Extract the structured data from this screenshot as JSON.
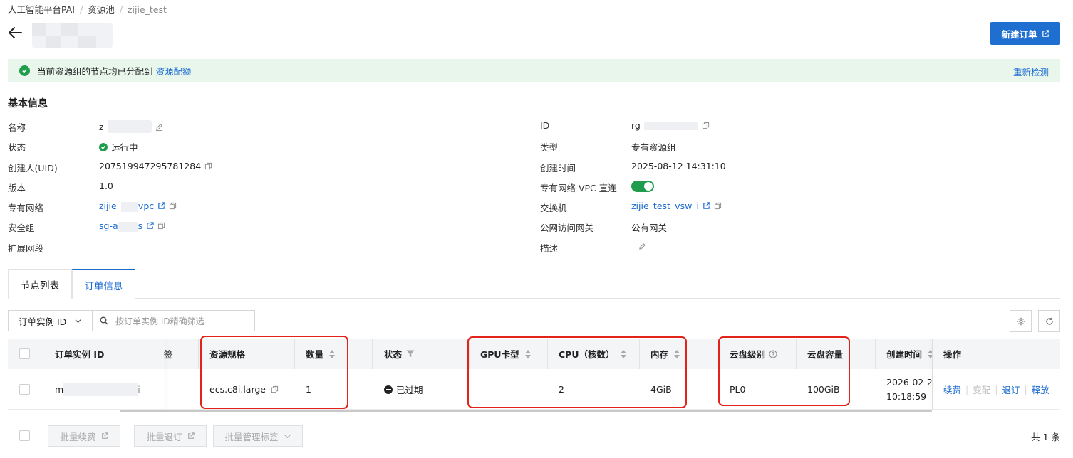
{
  "breadcrumb": [
    "人工智能平台PAI",
    "资源池",
    "zijie_test"
  ],
  "header": {
    "new_order_label": "新建订单"
  },
  "alert": {
    "text": "当前资源组的节点均已分配到",
    "link": "资源配额",
    "recheck": "重新检测"
  },
  "basic_info": {
    "title": "基本信息",
    "left": [
      {
        "label": "名称",
        "value": "z"
      },
      {
        "label": "状态",
        "value": "运行中"
      },
      {
        "label": "创建人(UID)",
        "value": "207519947295781284"
      },
      {
        "label": "版本",
        "value": "1.0"
      },
      {
        "label": "专有网络",
        "value": "zijie_",
        "value_suffix": "vpc"
      },
      {
        "label": "安全组",
        "value": "sg-a",
        "value_suffix": "s"
      },
      {
        "label": "扩展网段",
        "value": "-"
      }
    ],
    "right": [
      {
        "label": "ID",
        "value": "rg"
      },
      {
        "label": "类型",
        "value": "专有资源组"
      },
      {
        "label": "创建时间",
        "value": "2025-08-12 14:31:10"
      },
      {
        "label": "专有网络 VPC 直连",
        "value": ""
      },
      {
        "label": "交换机",
        "value": "zijie_test_vsw_i"
      },
      {
        "label": "公网访问网关",
        "value": "公有网关"
      },
      {
        "label": "描述",
        "value": "-"
      }
    ]
  },
  "tabs": [
    {
      "label": "节点列表",
      "active": false
    },
    {
      "label": "订单信息",
      "active": true
    }
  ],
  "filter": {
    "select_value": "订单实例 ID",
    "search_placeholder": "按订单实例 ID精确筛选"
  },
  "table": {
    "headers": {
      "instance_id": "订单实例 ID",
      "tag_partial": "签",
      "spec": "资源规格",
      "quantity": "数量",
      "status": "状态",
      "gpu": "GPU卡型",
      "cpu": "CPU（核数）",
      "memory": "内存",
      "disk_level": "云盘级别",
      "disk_size": "云盘容量",
      "created": "创建时间",
      "actions": "操作"
    },
    "row": {
      "instance_id": "m",
      "instance_id_tail": "i",
      "spec": "ecs.c8i.large",
      "quantity": "1",
      "status": "已过期",
      "gpu": "-",
      "cpu": "2",
      "memory": "4GiB",
      "disk_level": "PL0",
      "disk_size": "100GiB",
      "created_date": "2026-02-2",
      "created_time": "10:18:59",
      "actions": [
        "续费",
        "变配",
        "退订",
        "释放"
      ]
    }
  },
  "footer": {
    "buttons": [
      "批量续费",
      "批量退订",
      "批量管理标签"
    ],
    "total": "共 1 条"
  },
  "colors": {
    "primary": "#1f6fd0",
    "link": "#1b6bd0",
    "success": "#1f9d4c",
    "highlight": "#e2231a"
  }
}
